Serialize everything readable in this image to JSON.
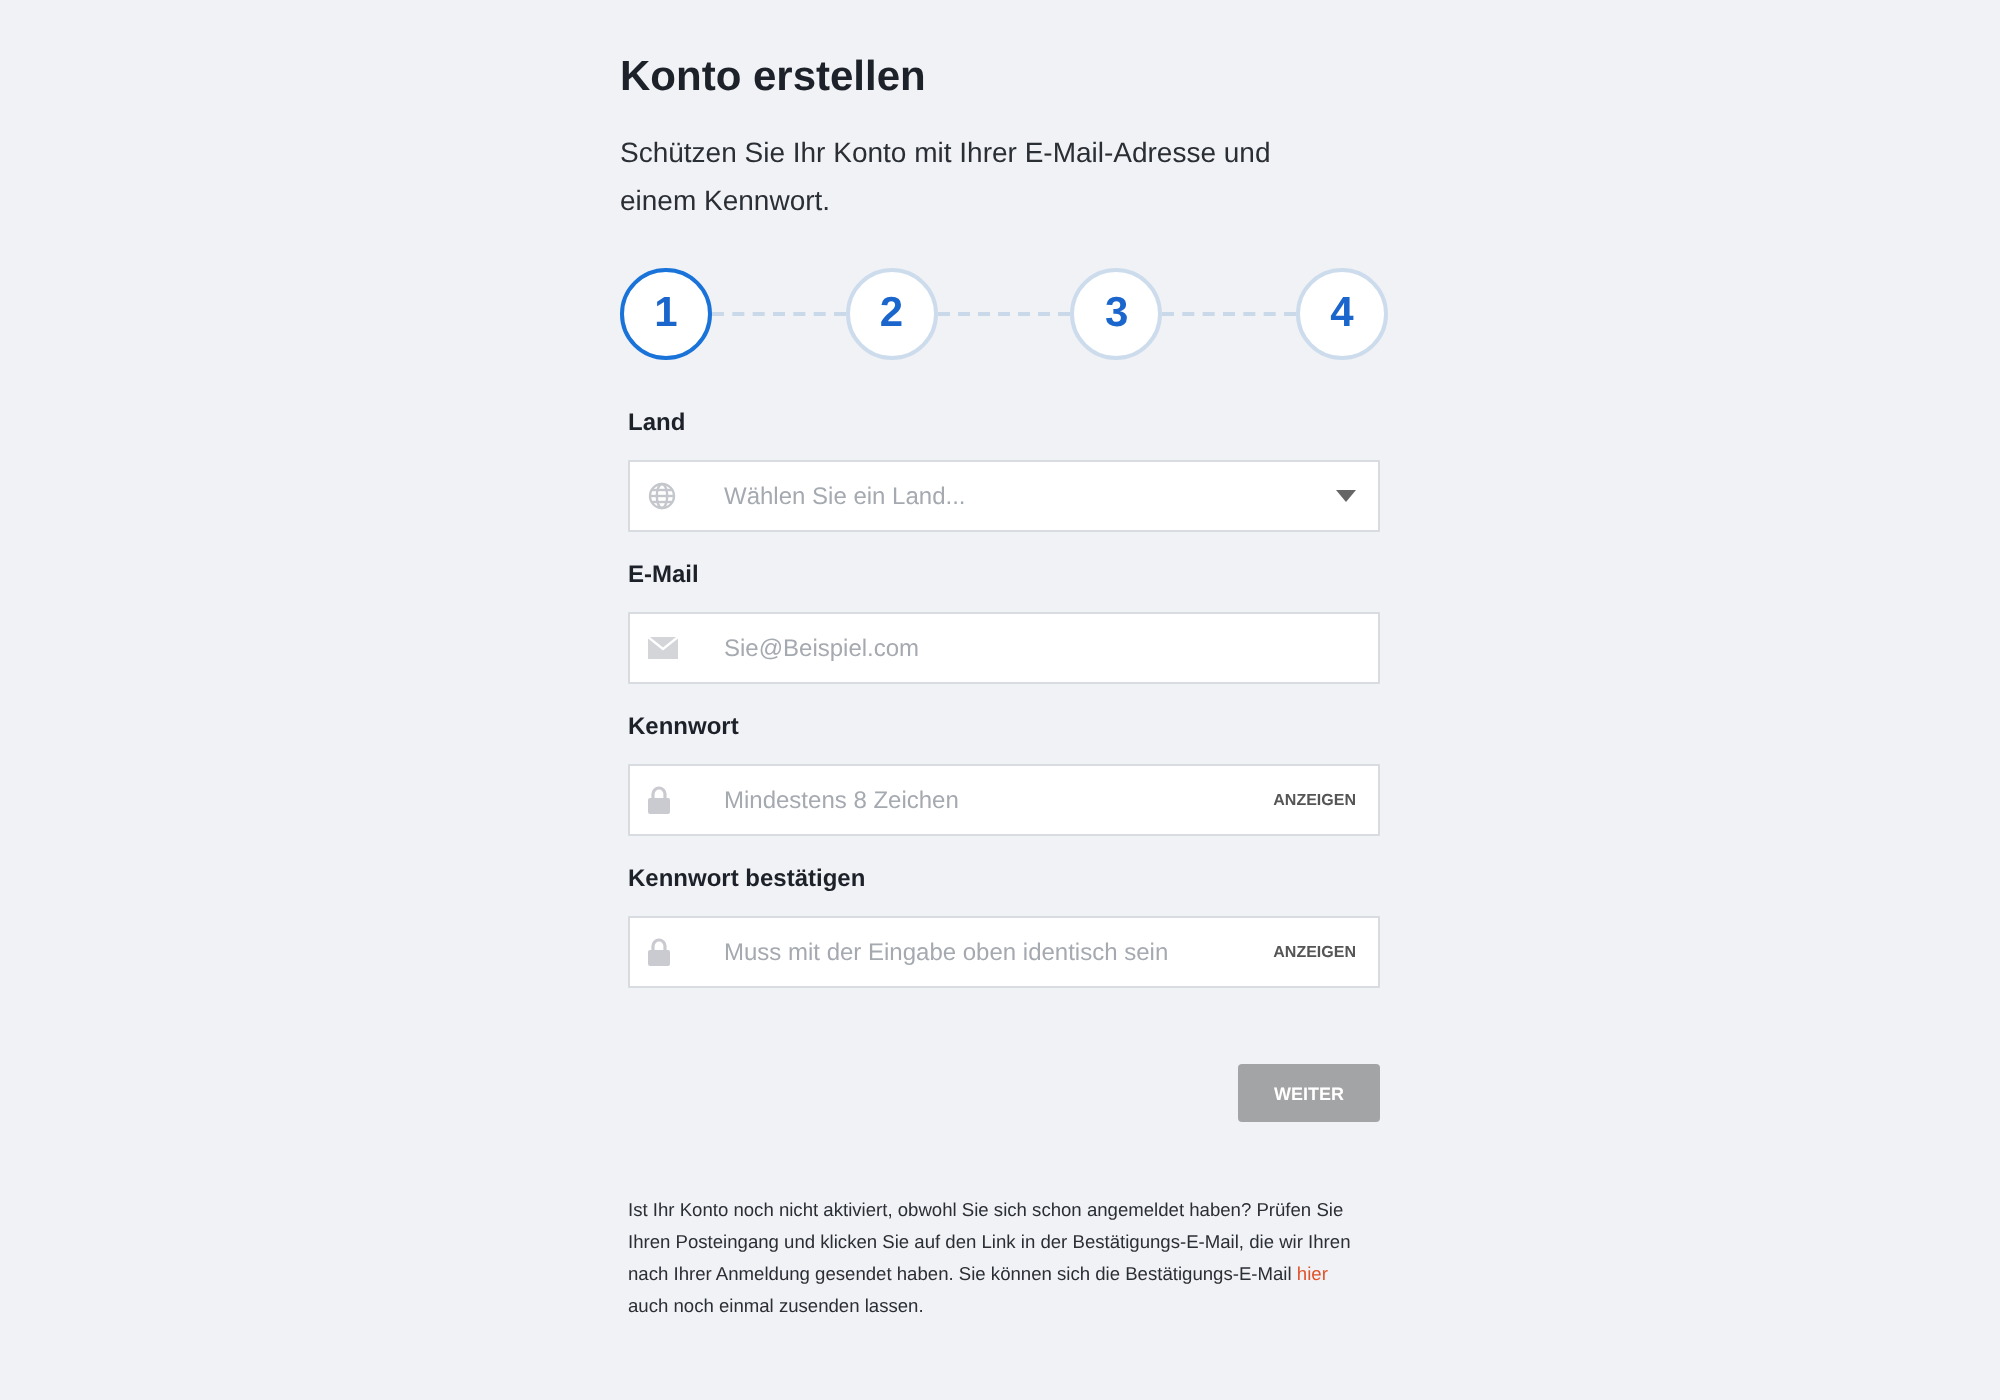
{
  "title": "Konto erstellen",
  "subtitle": "Schützen Sie Ihr Konto mit Ihrer E-Mail-Adresse und einem Kennwort.",
  "steps": [
    {
      "label": "1",
      "selected": true
    },
    {
      "label": "2",
      "selected": false
    },
    {
      "label": "3",
      "selected": false
    },
    {
      "label": "4",
      "selected": false
    }
  ],
  "fields": [
    {
      "kind": "select",
      "label": "Land",
      "placeholder": "Wählen Sie ein Land..."
    },
    {
      "kind": "email",
      "label": "E-Mail",
      "placeholder": "Sie@Beispiel.com"
    },
    {
      "kind": "password",
      "label": "Kennwort",
      "placeholder": "Mindestens 8 Zeichen",
      "toggle": "ANZEIGEN"
    },
    {
      "kind": "password",
      "label": "Kennwort bestätigen",
      "placeholder": "Muss mit der Eingabe oben identisch sein",
      "toggle": "ANZEIGEN"
    }
  ],
  "next_button": {
    "label": "WEITER",
    "disabled": true
  },
  "note": {
    "before": "Ist Ihr Konto noch nicht aktiviert, obwohl Sie sich schon angemeldet haben? Prüfen Sie Ihren Posteingang und klicken Sie auf den Link in der Bestätigungs-E-Mail, die wir Ihren nach Ihrer Anmeldung gesendet haben. Sie können sich die Bestätigungs-E-Mail",
    "link": "hier",
    "after": "auch noch einmal zusenden lassen."
  }
}
